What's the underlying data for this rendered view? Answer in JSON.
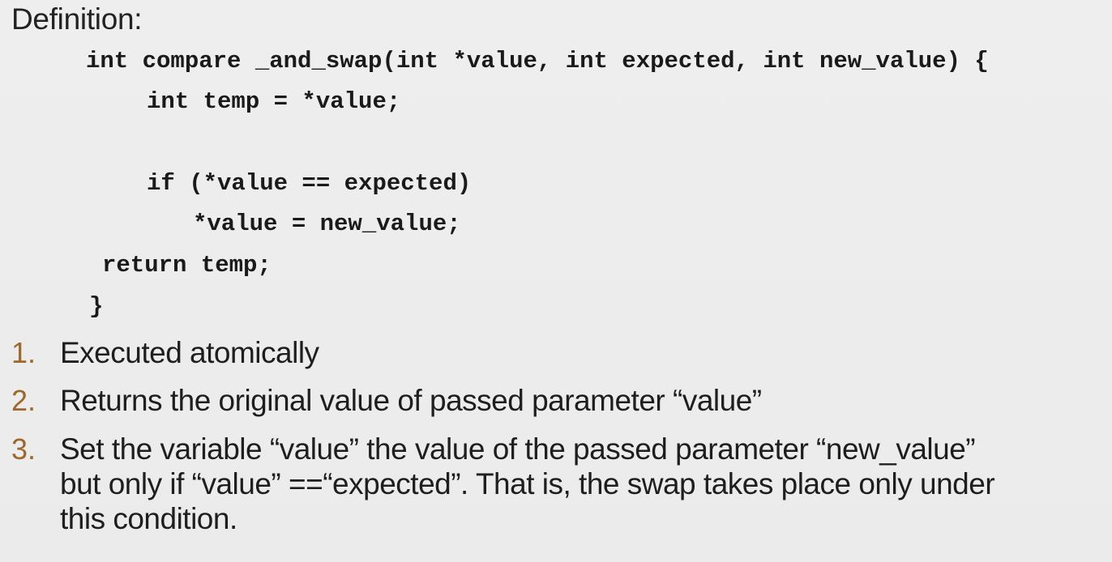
{
  "heading": "Definition:",
  "code_lines": [
    "int compare _and_swap(int *value, int expected, int new_value) {",
    "int temp = *value;",
    "if (*value == expected)",
    "*value = new_value;",
    "return temp;",
    "}"
  ],
  "items": [
    {
      "number": "1.",
      "lines": [
        "Executed atomically"
      ]
    },
    {
      "number": "2.",
      "lines": [
        "Returns the original value of passed parameter “value”"
      ]
    },
    {
      "number": "3.",
      "lines": [
        "Set  the variable “value”  the value of the passed parameter “new_value”",
        "but only if “value” ==“expected”. That is, the swap takes place only under",
        "this condition."
      ]
    }
  ]
}
